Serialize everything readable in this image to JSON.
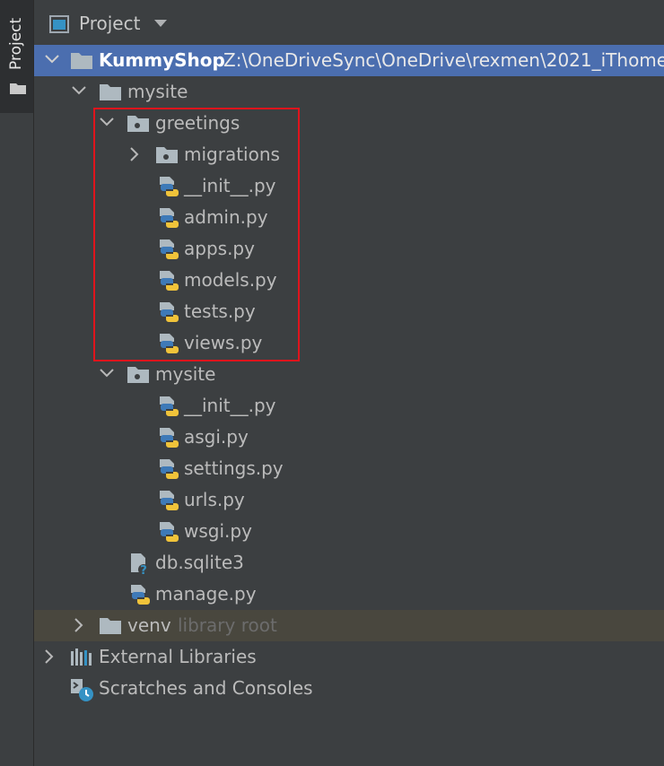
{
  "sidebar": {
    "tab_label": "Project"
  },
  "header": {
    "title": "Project"
  },
  "tree": {
    "root": {
      "name": "KummyShop",
      "path": "Z:\\OneDriveSync\\OneDrive\\rexmen\\2021_iThome"
    },
    "mysite_outer": "mysite",
    "greetings": "greetings",
    "migrations": "migrations",
    "greetings_files": [
      "__init__.py",
      "admin.py",
      "apps.py",
      "models.py",
      "tests.py",
      "views.py"
    ],
    "mysite_inner": "mysite",
    "mysite_files": [
      "__init__.py",
      "asgi.py",
      "settings.py",
      "urls.py",
      "wsgi.py"
    ],
    "db": "db.sqlite3",
    "manage": "manage.py",
    "venv": {
      "name": "venv",
      "hint": "library root"
    },
    "external": "External Libraries",
    "scratches": "Scratches and Consoles"
  },
  "colors": {
    "selection": "#4b6eaf",
    "excluded_row": "#49473e",
    "highlight_box": "#e0141c"
  }
}
